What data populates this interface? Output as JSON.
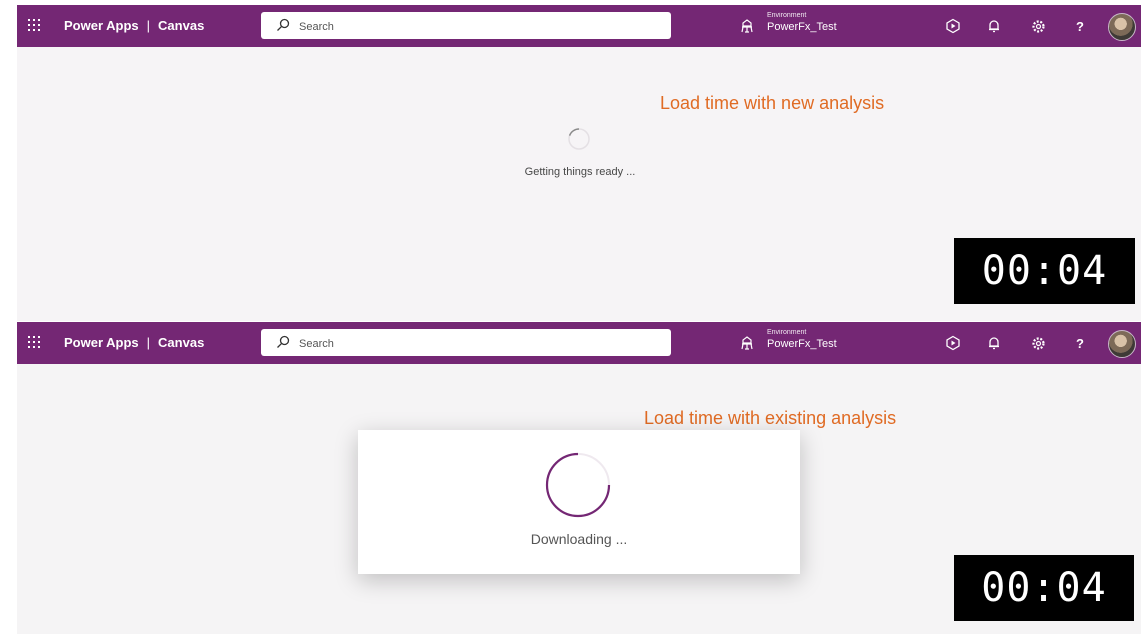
{
  "app": {
    "brand_name": "Power Apps",
    "brand_separator": "|",
    "brand_section": "Canvas",
    "search_placeholder": "Search",
    "environment_label": "Environment",
    "environment_name": "PowerFx_Test",
    "help_glyph": "?",
    "brand_color": "#742774"
  },
  "icons": [
    "app-launcher-icon",
    "search-icon",
    "environment-icon",
    "play-icon",
    "notification-icon",
    "settings-icon",
    "help-icon",
    "avatar"
  ],
  "top_panel": {
    "loading_text": "Getting things ready ...",
    "annotation": "Load time with new analysis",
    "timer": "00:04"
  },
  "bottom_panel": {
    "dialog_text": "Downloading ...",
    "annotation": "Load time with existing analysis",
    "timer": "00:04"
  },
  "colors": {
    "annotation": "#e06b24",
    "spinner": "#742774",
    "timer_background": "#000000"
  }
}
